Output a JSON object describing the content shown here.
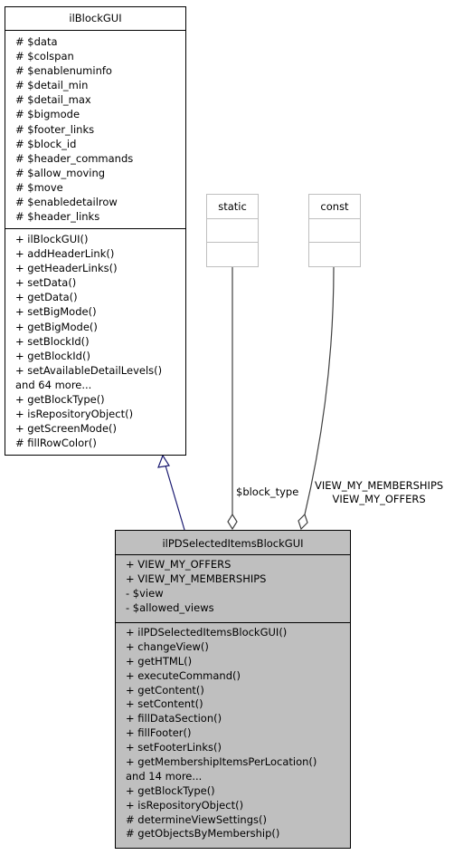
{
  "base_class": {
    "name": "ilBlockGUI",
    "attributes": [
      "# $data",
      "# $colspan",
      "# $enablenuminfo",
      "# $detail_min",
      "# $detail_max",
      "# $bigmode",
      "# $footer_links",
      "# $block_id",
      "# $header_commands",
      "# $allow_moving",
      "# $move",
      "# $enabledetailrow",
      "# $header_links"
    ],
    "operations": [
      "+ ilBlockGUI()",
      "+ addHeaderLink()",
      "+ getHeaderLinks()",
      "+ setData()",
      "+ getData()",
      "+ setBigMode()",
      "+ getBigMode()",
      "+ setBlockId()",
      "+ getBlockId()",
      "+ setAvailableDetailLevels()",
      "and 64 more...",
      "+ getBlockType()",
      "+ isRepositoryObject()",
      "+ getScreenMode()",
      "# fillRowColor()"
    ]
  },
  "static_box": {
    "name": "static"
  },
  "const_box": {
    "name": "const"
  },
  "edge_labels": {
    "block_type": "$block_type",
    "views_line1": "VIEW_MY_MEMBERSHIPS",
    "views_line2": "VIEW_MY_OFFERS"
  },
  "derived_class": {
    "name": "ilPDSelectedItemsBlockGUI",
    "attributes": [
      "+ VIEW_MY_OFFERS",
      "+ VIEW_MY_MEMBERSHIPS",
      "- $view",
      "- $allowed_views"
    ],
    "operations": [
      "+ ilPDSelectedItemsBlockGUI()",
      "+ changeView()",
      "+ getHTML()",
      "+ executeCommand()",
      "+ getContent()",
      "+ setContent()",
      "+ fillDataSection()",
      "+ fillFooter()",
      "+ setFooterLinks()",
      "+ getMembershipItemsPerLocation()",
      "and 14 more...",
      "+ getBlockType()",
      "+ isRepositoryObject()",
      "# determineViewSettings()",
      "# getObjectsByMembership()"
    ]
  },
  "colors": {
    "inheritance_edge": "#191970",
    "usage_edge": "#404040",
    "derived_fill": "#bfbfbf",
    "template_border": "#bfbfbf"
  }
}
